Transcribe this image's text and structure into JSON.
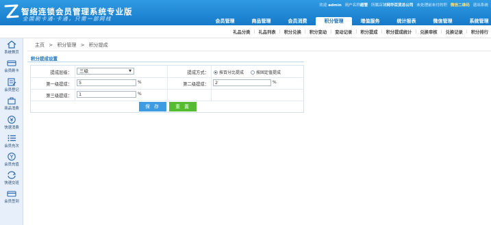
{
  "header": {
    "title": "智络连锁会员管理系统专业版",
    "subtitle": "全国刷卡通-卡通，只需一部网线",
    "welcome": "欢迎",
    "user": "admin",
    "user_name_label": "用户名称",
    "user_name": "超管",
    "store_label": "所属店铺",
    "store": "网华百货总公司",
    "message": "未处理前未付的积",
    "wechat": "微信二维码",
    "logout": "退出系统"
  },
  "main_nav": [
    "会员管理",
    "商品管理",
    "会员消费",
    "积分管理",
    "增值服务",
    "统计报表",
    "微信管理",
    "系统管理"
  ],
  "main_nav_active": 3,
  "sub_nav": [
    "礼品分类",
    "礼品列表",
    "积分兑换",
    "积分变动",
    "变动记录",
    "积分提成",
    "积分提成统计",
    "兑换审核",
    "兑换记录",
    "积分排行"
  ],
  "sidebar": [
    {
      "label": "系统首页",
      "icon": "home-icon"
    },
    {
      "label": "会员刷卡",
      "icon": "card-swipe-icon"
    },
    {
      "label": "会员登记",
      "icon": "register-icon"
    },
    {
      "label": "商品消费",
      "icon": "bag-icon"
    },
    {
      "label": "快速消费",
      "icon": "yen-icon"
    },
    {
      "label": "会员充次",
      "icon": "list-icon"
    },
    {
      "label": "会员充值",
      "icon": "recharge-icon"
    },
    {
      "label": "快速交班",
      "icon": "refresh-icon"
    },
    {
      "label": "会员签到",
      "icon": "signin-icon"
    }
  ],
  "breadcrumb": {
    "home": "主页",
    "sep": ">",
    "level1": "积分管理",
    "level2": "积分提成"
  },
  "panel": {
    "title": "积分提成设置",
    "level_label": "提成层级：",
    "level_value": "三级",
    "mode_label": "提成方式：",
    "mode_option1": "按百分比提成",
    "mode_option2": "按固定值提成",
    "first_label": "第一级提成：",
    "first_value": "5",
    "second_label": "第二级提成：",
    "second_value": "2",
    "third_label": "第三级提成：",
    "third_value": "1",
    "pct": "%",
    "save": "保 存",
    "reset": "重 置"
  },
  "colors": {
    "header": "#1f86d6",
    "save_button": "#3d9be3",
    "reset_button": "#55bb31",
    "sidebar": "#e6effa"
  }
}
